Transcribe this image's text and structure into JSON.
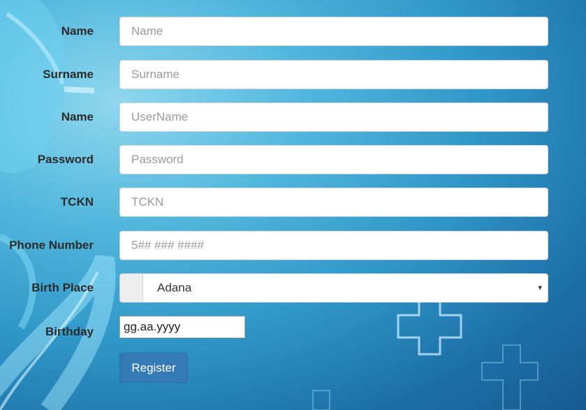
{
  "form": {
    "fields": [
      {
        "label": "Name",
        "placeholder": "Name"
      },
      {
        "label": "Surname",
        "placeholder": "Surname"
      },
      {
        "label": "Name",
        "placeholder": "UserName"
      },
      {
        "label": "Password",
        "placeholder": "Password"
      },
      {
        "label": "TCKN",
        "placeholder": "TCKN"
      },
      {
        "label": "Phone Number",
        "placeholder": "5## ### ####"
      }
    ],
    "birth_place": {
      "label": "Birth Place",
      "selected": "Adana",
      "arrow": "▾"
    },
    "birthday": {
      "label": "Birthday",
      "placeholder": "gg.aa.yyyy"
    },
    "register_label": "Register"
  },
  "colors": {
    "background": "#2f97c8",
    "button": "#337ab7"
  },
  "icons": [
    "stethoscope-graphic",
    "medical-cross-icon"
  ]
}
